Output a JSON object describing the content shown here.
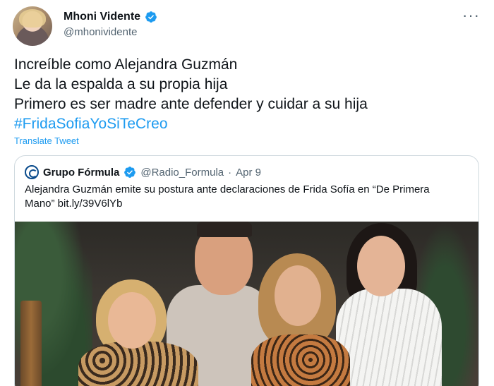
{
  "author": {
    "display_name": "Mhoni Vidente",
    "handle": "@mhonividente",
    "verified": true,
    "avatar_icon": "profile-photo"
  },
  "menu": {
    "more_label": "···"
  },
  "tweet": {
    "lines": [
      "Increíble como Alejandra Guzmán",
      "Le da la espalda a su propia hija",
      "Primero es ser madre ante defender y cuidar a su hija"
    ],
    "hashtag": "#FridaSofiaYoSiTeCreo",
    "translate_label": "Translate Tweet"
  },
  "quoted_tweet": {
    "display_name": "Grupo Fórmula",
    "handle": "@Radio_Formula",
    "separator": "·",
    "date": "Apr 9",
    "verified": true,
    "text": "Alejandra Guzmán emite su postura ante declaraciones de Frida Sofía en “De Primera Mano” bit.ly/39V6lYb",
    "image_icon": "group-photo"
  },
  "colors": {
    "link": "#1d9bf0",
    "verified": "#1d9bf0",
    "secondary_text": "#536471",
    "border": "#cfd9de"
  }
}
